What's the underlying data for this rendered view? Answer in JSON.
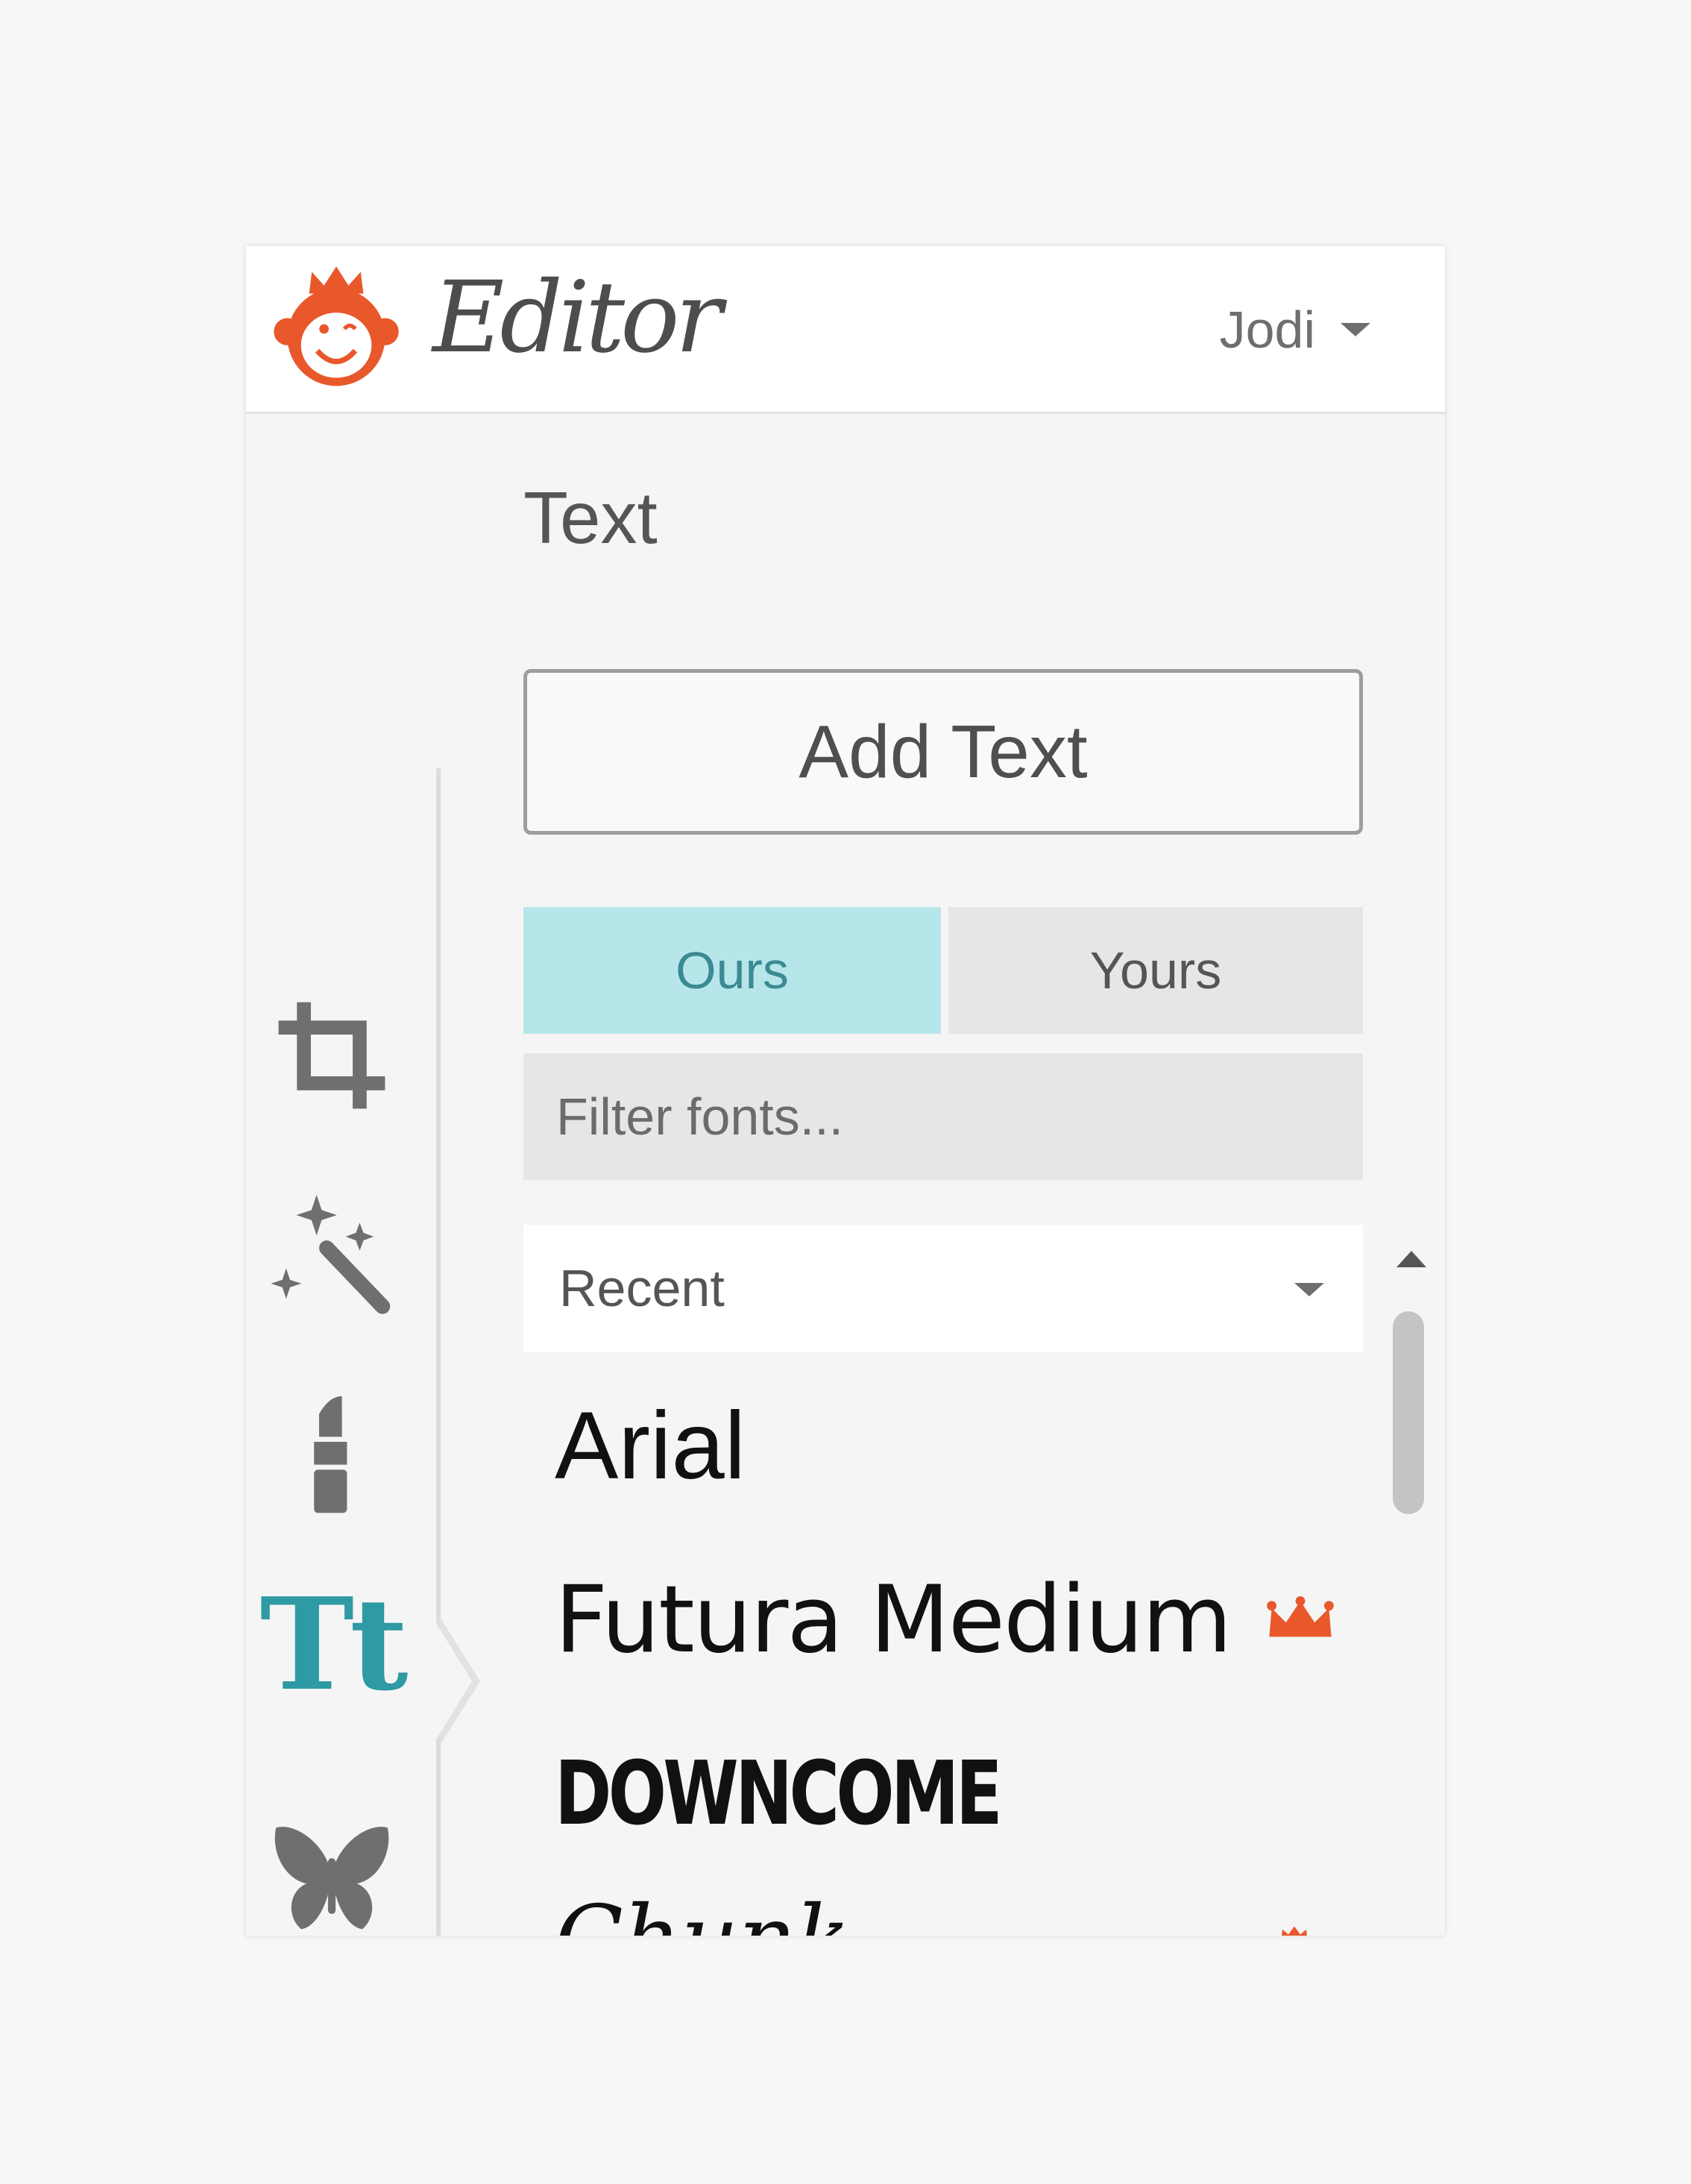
{
  "header": {
    "app_title": "Editor",
    "user_name": "Jodi"
  },
  "panel": {
    "title": "Text",
    "add_text_label": "Add Text",
    "tabs": [
      {
        "label": "Ours",
        "active": true
      },
      {
        "label": "Yours",
        "active": false
      }
    ],
    "filter_placeholder": "Filter fonts...",
    "category_select": "Recent",
    "fonts": [
      {
        "name": "Arial",
        "premium": false
      },
      {
        "name": "Futura Medium",
        "premium": true
      },
      {
        "name": "DOWNCOME",
        "premium": false
      },
      {
        "name": "Chunk",
        "premium": true
      }
    ]
  },
  "sidebar": {
    "tools": [
      {
        "icon": "crop-icon",
        "active": false
      },
      {
        "icon": "magic-wand-icon",
        "active": false
      },
      {
        "icon": "lipstick-icon",
        "active": false
      },
      {
        "icon": "text-tool-icon",
        "active": true,
        "glyph": "Tt"
      },
      {
        "icon": "butterfly-icon",
        "active": false
      }
    ]
  },
  "colors": {
    "brand": "#e8582a",
    "active_tab_bg": "#b7e6ea",
    "active_tab_text": "#3b8a94",
    "active_tool": "#2e9aa3",
    "icon_gray": "#6f6f6f"
  }
}
